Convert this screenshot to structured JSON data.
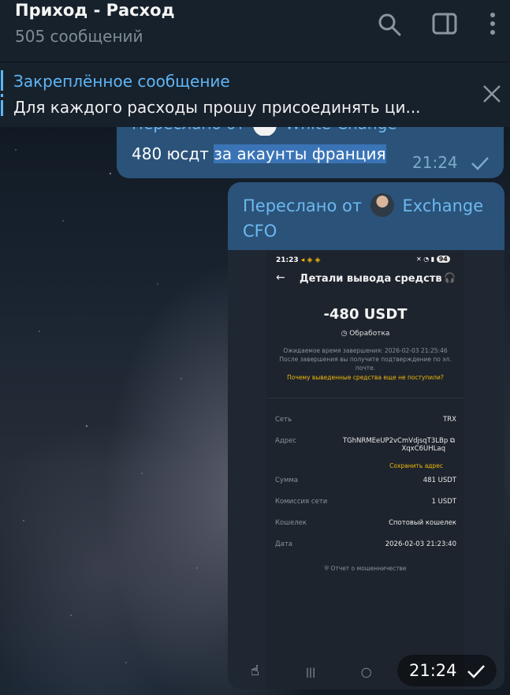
{
  "header": {
    "title": "Приход - Расход",
    "subtitle": "505 сообщений"
  },
  "pinned": {
    "title": "Закреплённое сообщение",
    "text": "Для каждого расходы прошу присоединять ци..."
  },
  "message1": {
    "forwarded_prefix": "Переслано от",
    "forwarded_name": "White-Change",
    "text_plain": "480 юсдт ",
    "text_highlight": "за акаунты франция",
    "time": "21:24"
  },
  "message2": {
    "forwarded_prefix": "Переслано от",
    "forwarded_name": "Exchange CFO",
    "time": "21:24",
    "screenshot": {
      "status_time": "21:23",
      "battery": "94",
      "title": "Детали вывода средств",
      "amount": "-480 USDT",
      "status": "Обработка",
      "note_line1": "Ожидаемое время завершения: 2026-02-03 21:25:46",
      "note_line2": "После завершения вы получите подтверждение по эл. почте.",
      "why_link": "Почему выведенные средства еще не поступили?",
      "rows": {
        "network_label": "Сеть",
        "network_value": "TRX",
        "address_label": "Адрес",
        "address_value1": "TGhNRMEeUP2vCmVdjsqT3LBp",
        "address_value2": "XqxC6UHLaq",
        "save_address": "Сохранить адрес",
        "sum_label": "Сумма",
        "sum_value": "481 USDT",
        "fee_label": "Комиссия сети",
        "fee_value": "1 USDT",
        "wallet_label": "Кошелек",
        "wallet_value": "Спотовый кошелек",
        "date_label": "Дата",
        "date_value": "2026-02-03 21:23:40"
      },
      "fraud_report": "Отчет о мошенничестве"
    }
  },
  "colors": {
    "accent": "#5eb5f7",
    "bubble": "#2b5278",
    "header_bg": "#17212b",
    "binance_yellow": "#f0b90b"
  }
}
